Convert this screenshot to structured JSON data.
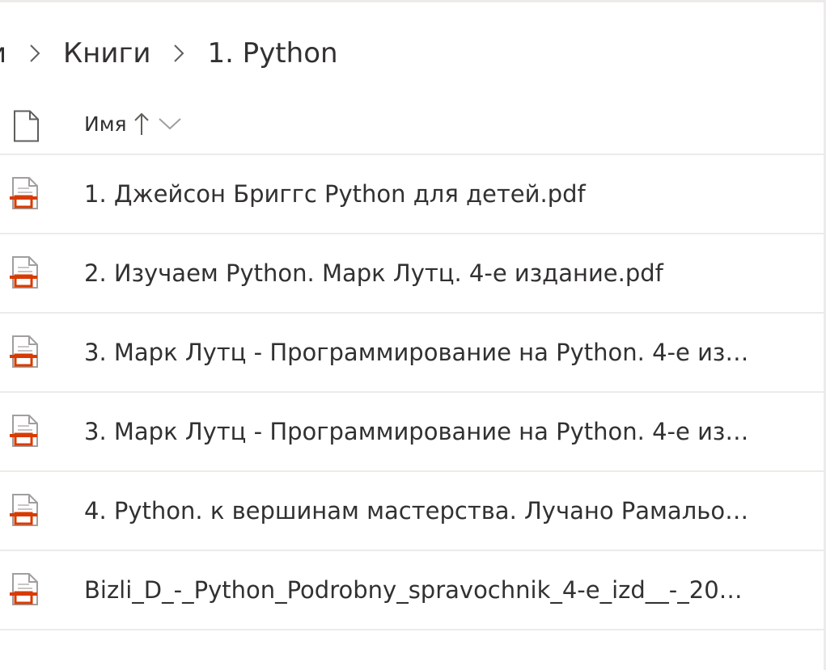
{
  "breadcrumb": {
    "partial_label": "и",
    "items": [
      {
        "label": "Книги"
      },
      {
        "label": "1. Python"
      }
    ]
  },
  "header": {
    "name_label": "Имя",
    "sort_direction": "ascending"
  },
  "files": [
    {
      "name": "1. Джейсон Бриггс Python для детей.pdf",
      "icon": "pdf-icon"
    },
    {
      "name": "2. Изучаем Python. Марк Лутц. 4-е издание.pdf",
      "icon": "pdf-icon"
    },
    {
      "name": "3. Марк Лутц - Программирование на Python. 4-е изда...",
      "icon": "pdf-icon"
    },
    {
      "name": "3. Марк Лутц - Программирование на Python. 4-е изда...",
      "icon": "pdf-icon"
    },
    {
      "name": "4. Python. к вершинам мастерства. Лучано Рамальо.pdf",
      "icon": "pdf-icon"
    },
    {
      "name": "Bizli_D_-_Python_Podrobny_spravochnik_4-e_izd__-_2010....",
      "icon": "pdf-icon"
    }
  ],
  "colors": {
    "pdf_accent": "#d83b01",
    "divider": "#edebe9",
    "text": "#323130",
    "muted": "#605e5c"
  }
}
